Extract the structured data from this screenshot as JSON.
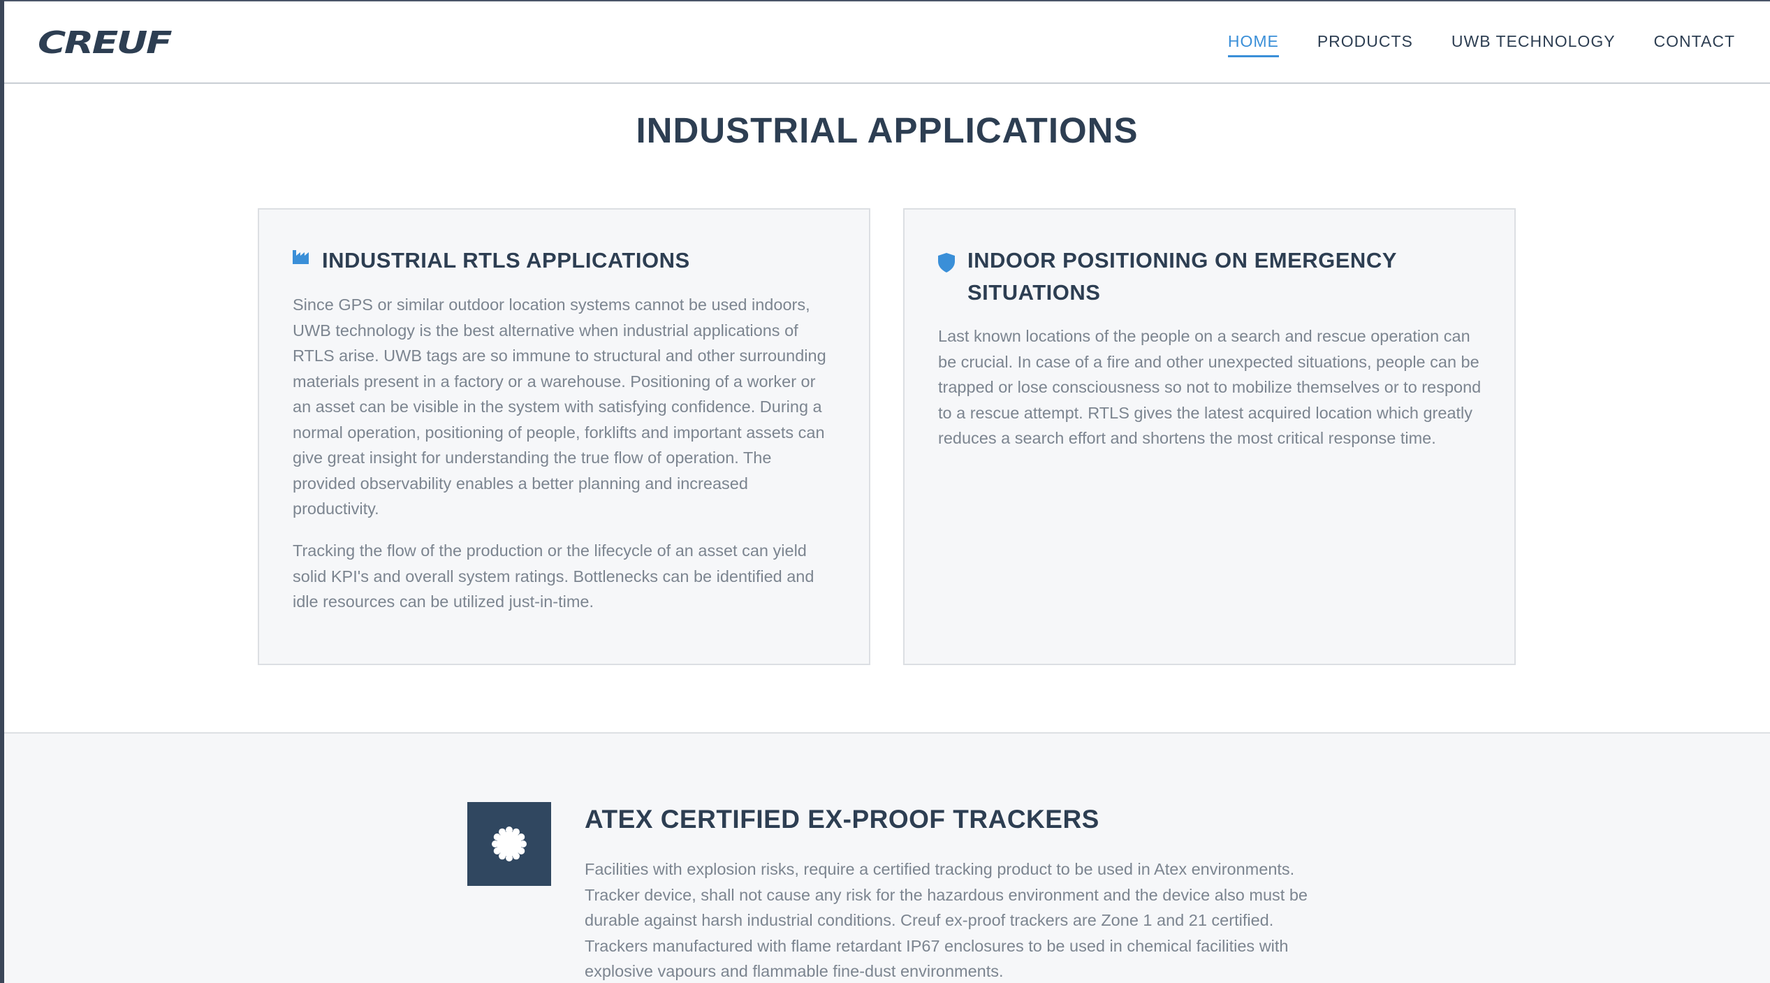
{
  "header": {
    "logo": "CREUF",
    "nav": [
      {
        "label": "HOME",
        "active": true
      },
      {
        "label": "PRODUCTS",
        "active": false
      },
      {
        "label": "UWB TECHNOLOGY",
        "active": false
      },
      {
        "label": "CONTACT",
        "active": false
      }
    ]
  },
  "applications": {
    "title": "INDUSTRIAL APPLICATIONS",
    "cards": [
      {
        "icon": "factory-icon",
        "title": "INDUSTRIAL RTLS APPLICATIONS",
        "paragraphs": [
          "Since GPS or similar outdoor location systems cannot be used indoors, UWB technology is the best alternative when industrial applications of RTLS arise. UWB tags are so immune to structural and other surrounding materials present in a factory or a warehouse. Positioning of a worker or an asset can be visible in the system with satisfying confidence. During a normal operation, positioning of people, forklifts and important assets can give great insight for understanding the true flow of operation. The provided observability enables a better planning and increased productivity.",
          "Tracking the flow of the production or the lifecycle of an asset can yield solid KPI's and overall system ratings. Bottlenecks can be identified and idle resources can be utilized just-in-time."
        ]
      },
      {
        "icon": "shield-icon",
        "title": "INDOOR POSITIONING ON EMERGENCY SITUATIONS",
        "paragraphs": [
          "Last known locations of the people on a search and rescue operation can be crucial. In case of a fire and other unexpected situations, people can be trapped or lose consciousness so not to mobilize themselves or to respond to a rescue attempt. RTLS gives the latest acquired location which greatly reduces a search effort and shortens the most critical response time."
        ]
      }
    ]
  },
  "atex": {
    "icon": "certificate-icon",
    "title": "ATEX CERTIFIED EX-PROOF TRACKERS",
    "body": "Facilities with explosion risks, require a certified tracking product to be used in Atex environments. Tracker device, shall not cause any risk for the hazardous environment and the device also must be durable against harsh industrial conditions. Creuf ex-proof trackers are Zone 1 and 21 certified. Trackers manufactured with flame retardant IP67 enclosures to be used in chemical facilities with explosive vapours and flammable fine-dust environments."
  },
  "colors": {
    "accent": "#3a8fd8",
    "heading": "#2d3e52",
    "body_text": "#7c8590",
    "card_bg": "#f6f7f9",
    "icon_box": "#304760"
  }
}
